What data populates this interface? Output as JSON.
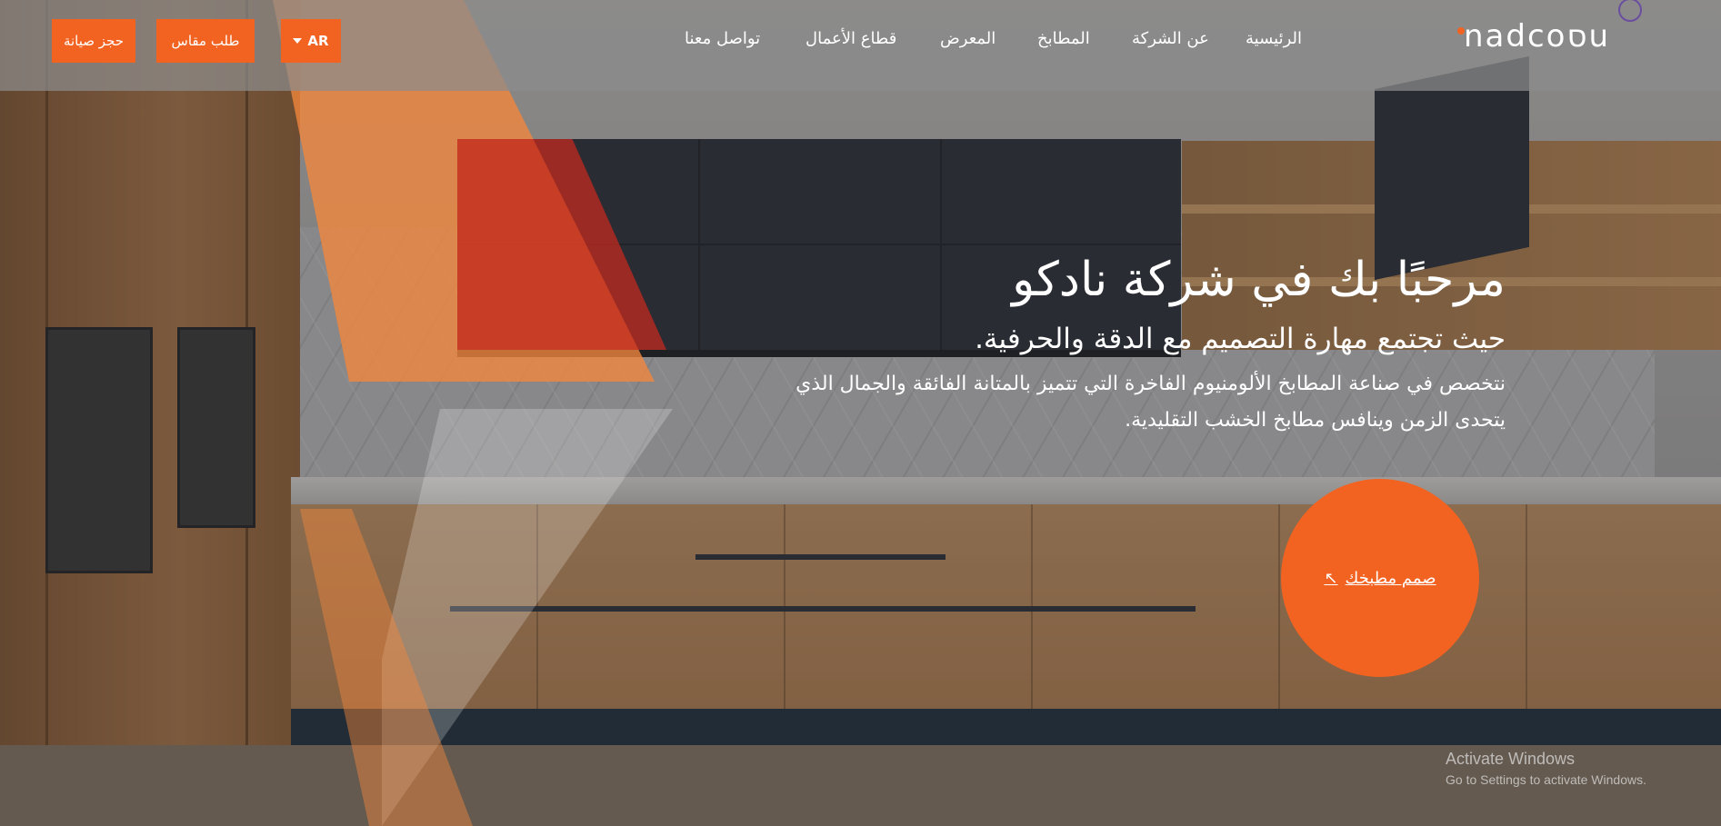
{
  "header": {
    "logo_text": "nadcoסu",
    "nav": [
      {
        "label": "الرئيسية"
      },
      {
        "label": "عن الشركة"
      },
      {
        "label": "المطابخ"
      },
      {
        "label": "المعرض"
      },
      {
        "label": "قطاع الأعمال"
      },
      {
        "label": "تواصل معنا"
      }
    ],
    "buttons": {
      "language": "AR",
      "measure": "طلب مقاس",
      "maintenance": "حجز صيانة"
    }
  },
  "hero": {
    "title": "مرحبًا بك في شركة نادكو",
    "subtitle": "حيث تجتمع مهارة التصميم مع الدقة والحرفية.",
    "description": "نتخصص في صناعة المطابخ الألومنيوم الفاخرة التي تتميز بالمتانة الفائقة والجمال الذي يتحدى الزمن وينافس مطابخ الخشب التقليدية.",
    "cta_label": "صمم مطبخك",
    "cta_icon": "arrow-up-left-icon"
  },
  "watermark": {
    "line1": "Activate Windows",
    "line2": "Go to Settings to activate Windows."
  },
  "colors": {
    "accent": "#f26322",
    "header_bg": "#8c8c8c"
  }
}
